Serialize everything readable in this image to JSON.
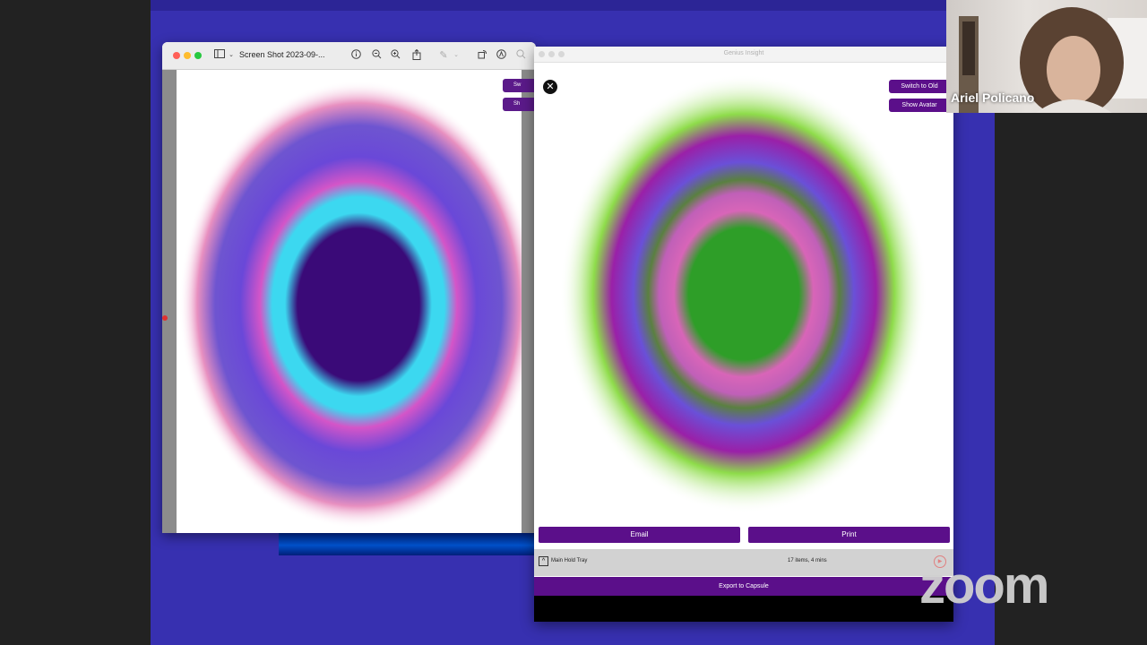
{
  "preview": {
    "title": "Screen Shot 2023-09-...",
    "side_buttons": [
      "Sw",
      "Sh"
    ]
  },
  "genius": {
    "title": "Genius Insight",
    "close_icon": "✕",
    "switch_label": "Switch to Old",
    "avatar_label": "Show Avatar",
    "email_label": "Email",
    "print_label": "Print",
    "tray_label": "Main Hold Tray",
    "tray_count": "17 items, 4 mins",
    "export_label": "Export to Capsule"
  },
  "webcam": {
    "participant_name": "Ariel Policano"
  },
  "zoom": {
    "logo_text": "zoom"
  },
  "colors": {
    "desktop": "#3730b0",
    "button_purple": "#5b0f8a",
    "aura_left_core": "#3a0a78",
    "aura_left_ring": "#3cd8f0",
    "aura_right_core": "#2e9e28",
    "aura_right_outer": "#8ee04a"
  }
}
